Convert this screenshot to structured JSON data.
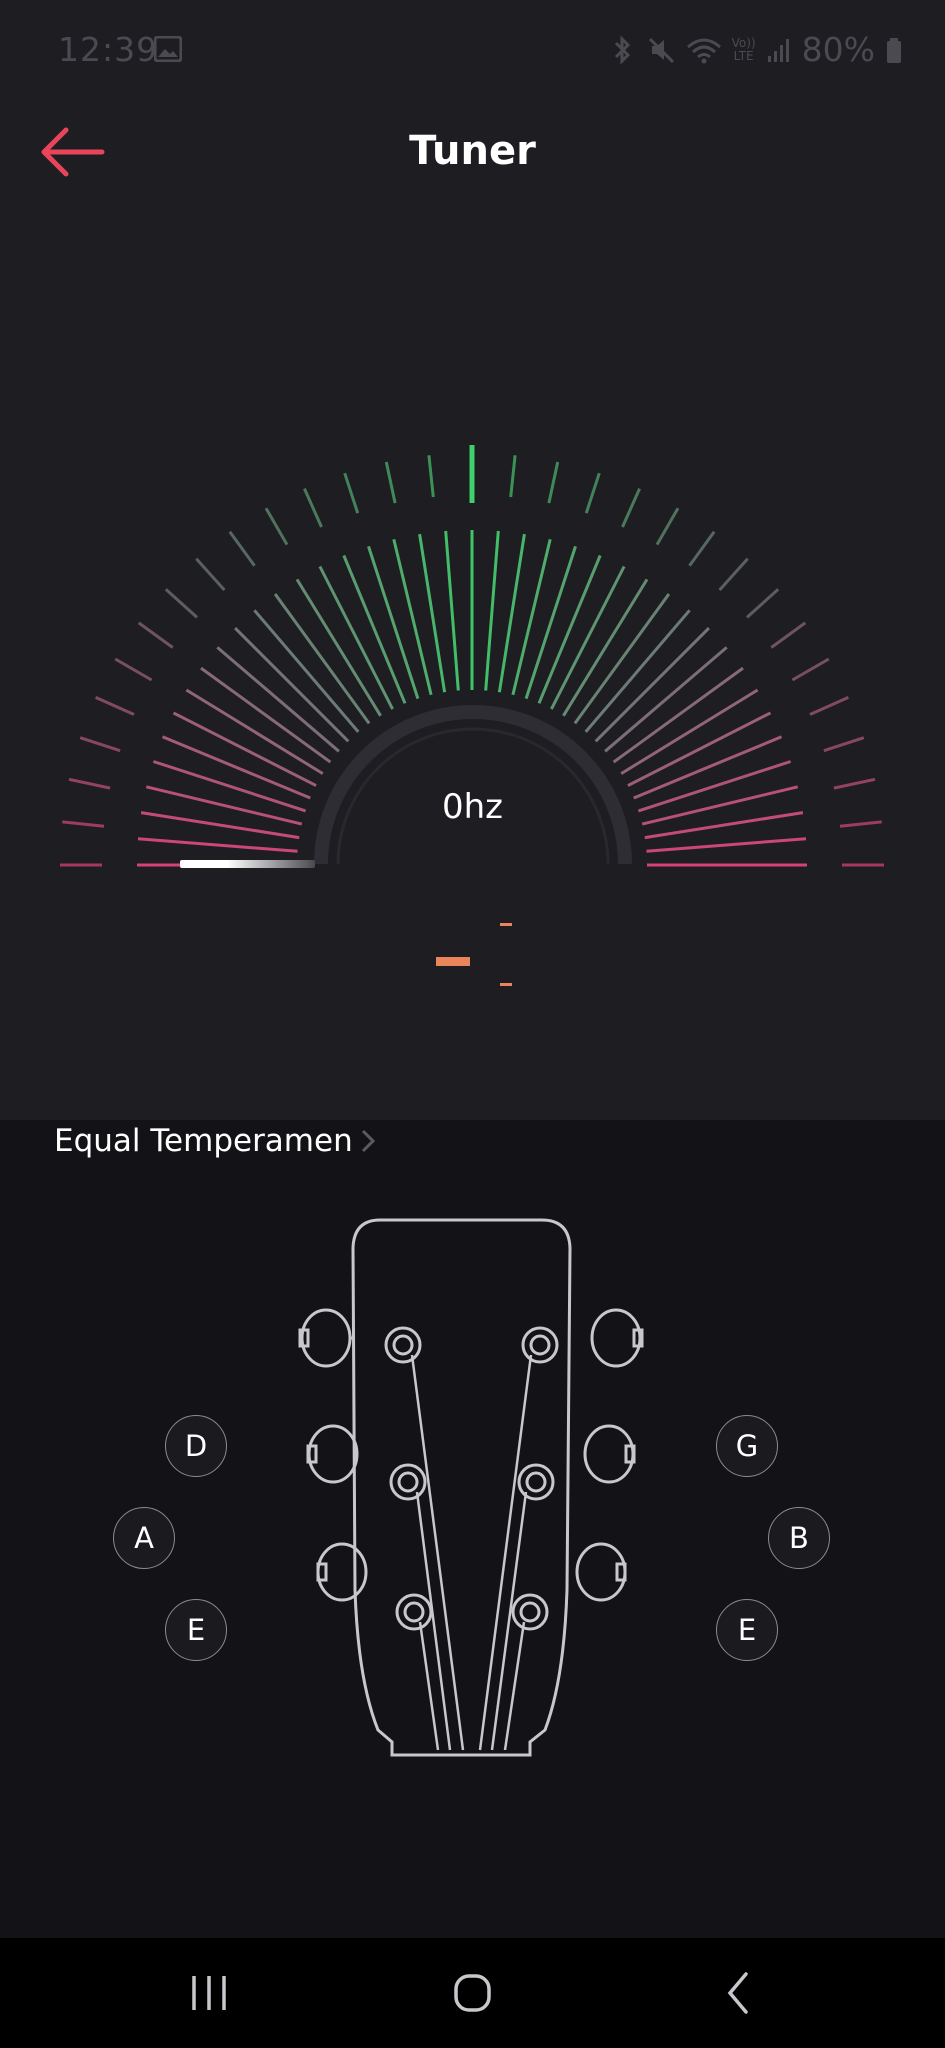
{
  "status_bar": {
    "time": "12:39",
    "battery": "80%",
    "volte_label": "Vo))",
    "lte_label": "LTE"
  },
  "header": {
    "title": "Tuner",
    "back_icon": "arrow-left-icon"
  },
  "tuner": {
    "frequency": "0hz"
  },
  "temperament": {
    "label": "Equal Temperamen"
  },
  "strings": {
    "left": [
      "D",
      "A",
      "E"
    ],
    "right": [
      "G",
      "B",
      "E"
    ]
  },
  "colors": {
    "accent": "#e8455a",
    "in_tune": "#3fcf6b",
    "off_tune": "#e0457a",
    "indicator": "#e9845b"
  },
  "nav": {
    "recents_icon": "recents-icon",
    "home_icon": "home-icon",
    "back_icon": "back-chevron-icon"
  }
}
